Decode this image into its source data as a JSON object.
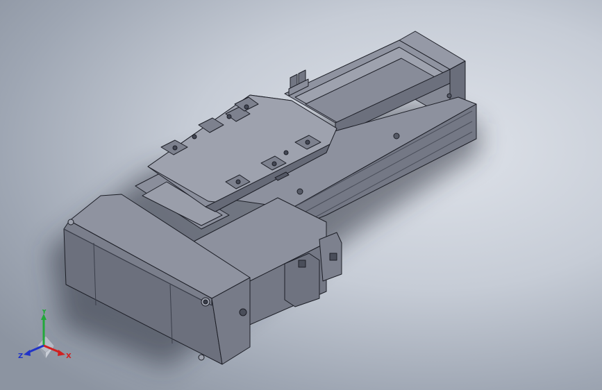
{
  "viewport": {
    "background_center": "#dfe3ea",
    "background_edge": "#8c94a1"
  },
  "model": {
    "body_color": "#7e828f",
    "top_color": "#9599a6",
    "side_color": "#6a6e7b",
    "edge_color": "#1c1e26"
  },
  "triad": {
    "x_label": "X",
    "y_label": "Y",
    "z_label": "Z",
    "x_color": "#d02020",
    "y_color": "#22a83a",
    "z_color": "#2033c8"
  }
}
